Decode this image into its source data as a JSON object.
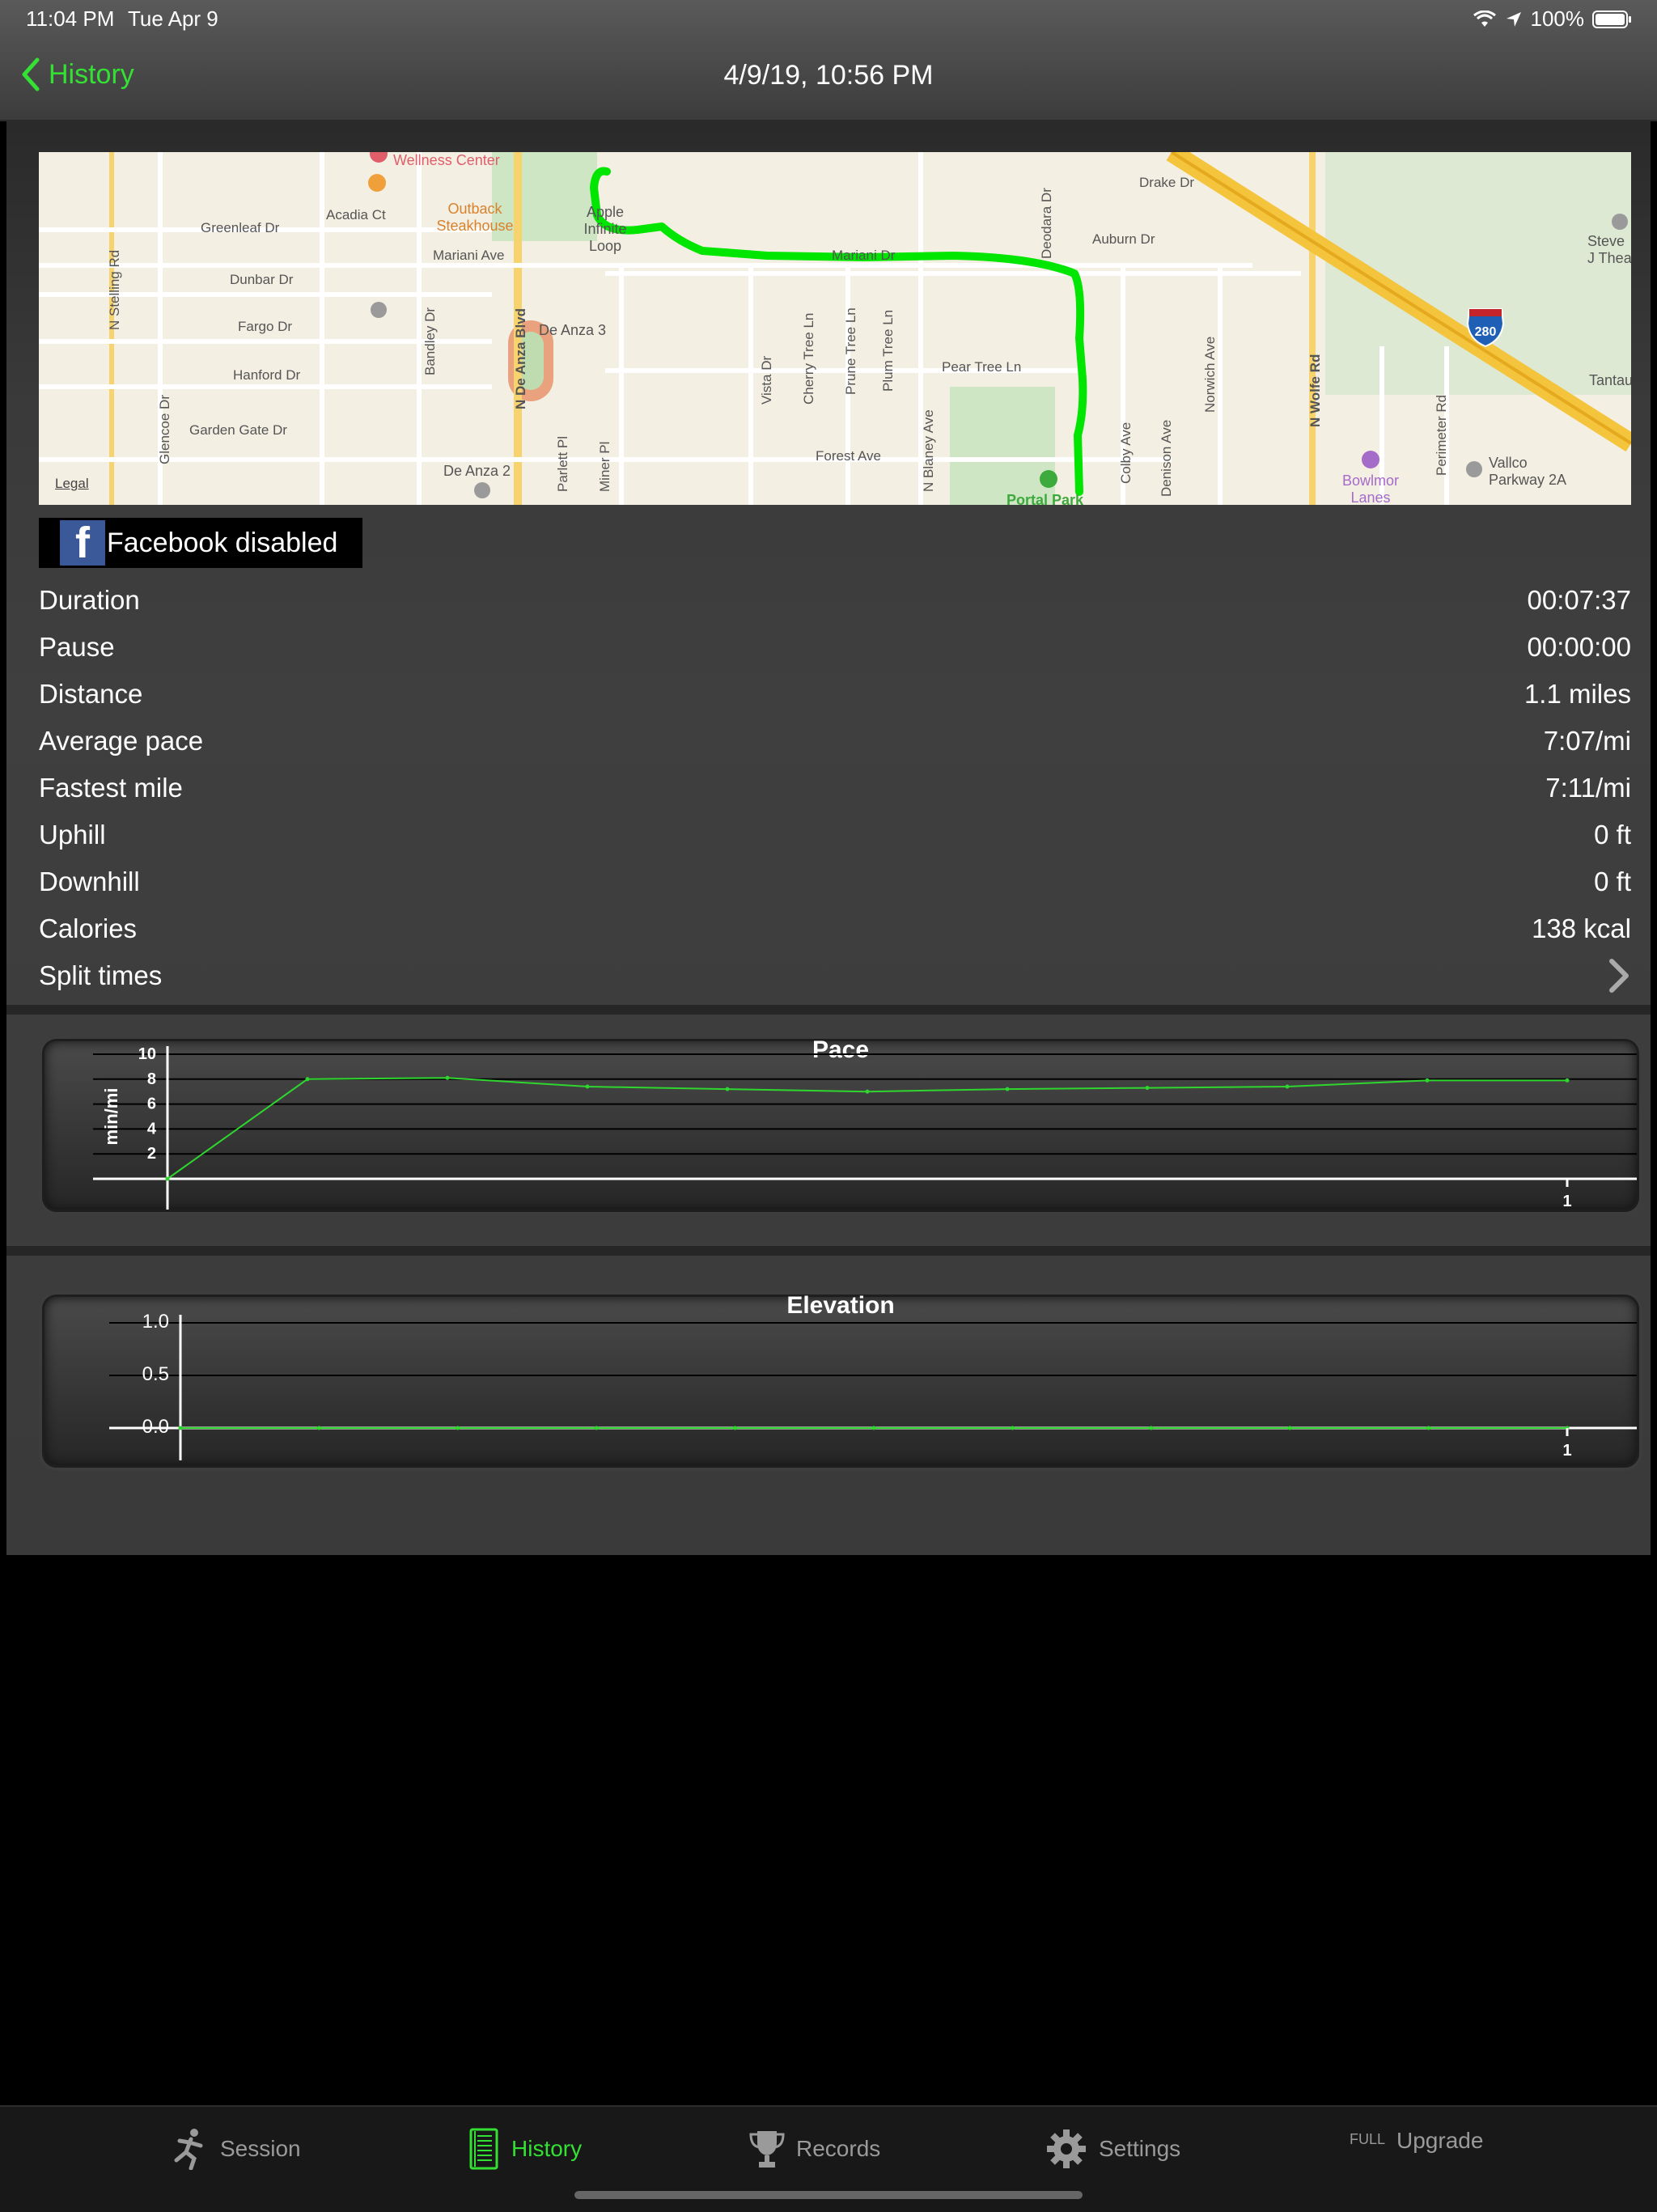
{
  "status": {
    "time": "11:04 PM",
    "date": "Tue Apr 9",
    "battery": "100%"
  },
  "nav": {
    "back_label": "History",
    "title": "4/9/19, 10:56 PM"
  },
  "map": {
    "legal_label": "Legal",
    "streets": [
      "Greenleaf Dr",
      "Acadia Ct",
      "Mariani Ave",
      "Dunbar Dr",
      "Fargo Dr",
      "Hanford Dr",
      "Garden Gate Dr",
      "N Stelling Rd",
      "Glencoe Dr",
      "Bandley Dr",
      "N De Anza Blvd",
      "Parlett Pl",
      "Miner Pl",
      "Cherry Tree Ln",
      "Prune Tree Ln",
      "Plum Tree Ln",
      "Vista Dr",
      "N Blaney Ave",
      "Pear Tree Ln",
      "Forest Ave",
      "Colby Ave",
      "Denison Ave",
      "Norwich Ave",
      "Deodara Dr",
      "Auburn Dr",
      "Drake Dr",
      "N Wolfe Rd",
      "Perimeter Rd",
      "Mariani Dr"
    ],
    "places": [
      "Wellness Center",
      "Outback Steakhouse",
      "Apple Infinite Loop",
      "De Anza 3",
      "De Anza 2",
      "Portal Park",
      "Bowlmor Lanes",
      "Vallco Parkway 2A",
      "Steve J Thea",
      "Tantau"
    ],
    "highway": "280"
  },
  "facebook": {
    "label": "Facebook disabled"
  },
  "stats": [
    {
      "label": "Duration",
      "value": "00:07:37"
    },
    {
      "label": "Pause",
      "value": "00:00:00"
    },
    {
      "label": "Distance",
      "value": "1.1 miles"
    },
    {
      "label": "Average pace",
      "value": "7:07/mi"
    },
    {
      "label": "Fastest mile",
      "value": "7:11/mi"
    },
    {
      "label": "Uphill",
      "value": "0 ft"
    },
    {
      "label": "Downhill",
      "value": "0 ft"
    },
    {
      "label": "Calories",
      "value": "138 kcal"
    }
  ],
  "split_times_label": "Split times",
  "chart_data": [
    {
      "type": "line",
      "title": "Pace",
      "ylabel": "min/mi",
      "ylim": [
        0,
        10
      ],
      "yticks": [
        "10",
        "8",
        "6",
        "4",
        "2"
      ],
      "xtick_label": "1",
      "color": "#2ed62e",
      "values": [
        0,
        8.0,
        8.1,
        7.4,
        7.2,
        7.0,
        7.2,
        7.3,
        7.4,
        7.9,
        7.9
      ]
    },
    {
      "type": "line",
      "title": "Elevation",
      "ylabel": "",
      "ylim": [
        0,
        1
      ],
      "yticks": [
        "1.0",
        "0.5",
        "0.0"
      ],
      "xtick_label": "1",
      "color": "#2ed62e",
      "values": [
        0,
        0,
        0,
        0,
        0,
        0,
        0,
        0,
        0,
        0,
        0
      ]
    }
  ],
  "tabs": [
    {
      "label": "Session",
      "icon": "runner-icon"
    },
    {
      "label": "History",
      "icon": "notebook-icon"
    },
    {
      "label": "Records",
      "icon": "trophy-icon"
    },
    {
      "label": "Settings",
      "icon": "gear-icon"
    },
    {
      "label": "Upgrade",
      "badge": "FULL"
    }
  ]
}
